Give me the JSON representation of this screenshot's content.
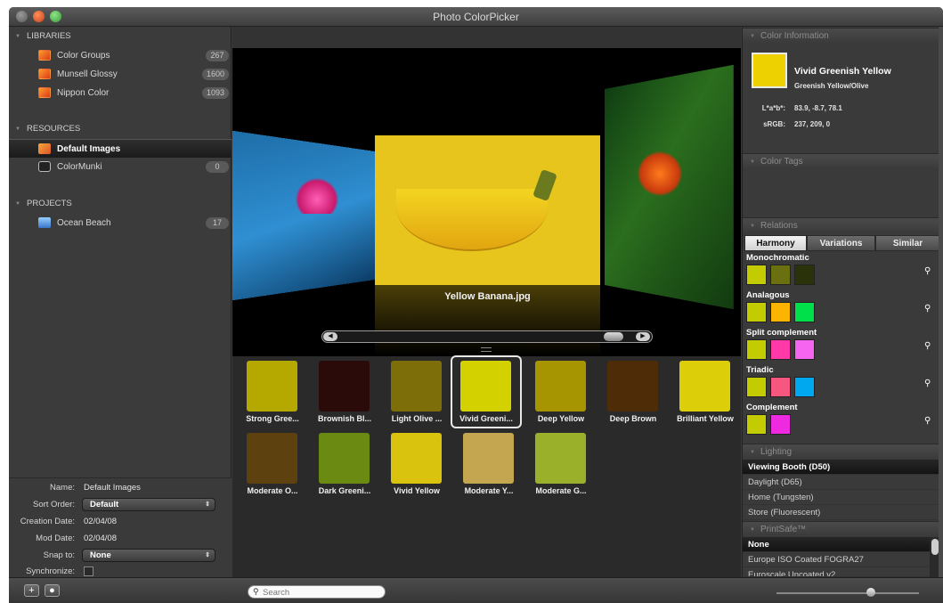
{
  "window": {
    "title": "Photo ColorPicker"
  },
  "sidebar": {
    "libraries_header": "LIBRARIES",
    "libraries": [
      {
        "label": "Color Groups",
        "count": "267"
      },
      {
        "label": "Munsell Glossy",
        "count": "1600"
      },
      {
        "label": "Nippon Color",
        "count": "1093"
      }
    ],
    "resources_header": "RESOURCES",
    "resources": [
      {
        "label": "Default Images",
        "count": ""
      },
      {
        "label": "ColorMunki",
        "count": "0"
      }
    ],
    "projects_header": "PROJECTS",
    "projects": [
      {
        "label": "Ocean Beach",
        "count": "17"
      }
    ]
  },
  "info": {
    "name_label": "Name:",
    "name_value": "Default Images",
    "sort_label": "Sort Order:",
    "sort_value": "Default",
    "creation_label": "Creation Date:",
    "creation_value": "02/04/08",
    "mod_label": "Mod Date:",
    "mod_value": "02/04/08",
    "snap_label": "Snap to:",
    "snap_value": "None",
    "sync_label": "Synchronize:"
  },
  "coverflow": {
    "caption": "Yellow Banana.jpg"
  },
  "swatches": [
    {
      "label": "Strong Gree...",
      "color": "#b5a900"
    },
    {
      "label": "Brownish Bl...",
      "color": "#2b0a0a"
    },
    {
      "label": "Light Olive ...",
      "color": "#7e6e0a"
    },
    {
      "label": "Vivid Greeni...",
      "color": "#d4d100"
    },
    {
      "label": "Deep Yellow",
      "color": "#a69400"
    },
    {
      "label": "Deep Brown",
      "color": "#4e2c08"
    },
    {
      "label": "Brilliant Yellow",
      "color": "#dccf0a"
    },
    {
      "label": "Moderate O...",
      "color": "#5d4210"
    },
    {
      "label": "Dark Greeni...",
      "color": "#6a8a12"
    },
    {
      "label": "Vivid Yellow",
      "color": "#d9c30e"
    },
    {
      "label": "Moderate Y...",
      "color": "#c4a650"
    },
    {
      "label": "Moderate G...",
      "color": "#9bb02a"
    }
  ],
  "color_info": {
    "header": "Color Information",
    "name": "Vivid Greenish Yellow",
    "sub": "Greenish Yellow/Olive",
    "lab_label": "L*a*b*:",
    "lab_value": "83.9, -8.7, 78.1",
    "srgb_label": "sRGB:",
    "srgb_value": "237, 209, 0",
    "color": "#edd100"
  },
  "color_tags": {
    "header": "Color Tags"
  },
  "relations": {
    "header": "Relations",
    "tabs": [
      "Harmony",
      "Variations",
      "Similar"
    ],
    "groups": [
      {
        "name": "Monochromatic",
        "colors": [
          "#c3cc00",
          "#6a6f10",
          "#2a320a"
        ]
      },
      {
        "name": "Analagous",
        "colors": [
          "#c3cc00",
          "#fbb400",
          "#00e04a"
        ]
      },
      {
        "name": "Split complement",
        "colors": [
          "#c3cc00",
          "#ff3aa8",
          "#f565f0"
        ]
      },
      {
        "name": "Triadic",
        "colors": [
          "#c3cc00",
          "#f6577f",
          "#00a8f0"
        ]
      },
      {
        "name": "Complement",
        "colors": [
          "#c3cc00",
          "#ee2ae0"
        ]
      }
    ]
  },
  "lighting": {
    "header": "Lighting",
    "items": [
      "Viewing Booth (D50)",
      "Daylight (D65)",
      "Home (Tungsten)",
      "Store (Fluorescent)"
    ]
  },
  "printsafe": {
    "header": "PrintSafe™",
    "items": [
      "None",
      "Europe ISO Coated FOGRA27",
      "Euroscale Uncoated v2"
    ]
  },
  "bottom": {
    "search_placeholder": "Search"
  },
  "icons": {
    "search": "search-icon",
    "zoom": "magnifier-icon",
    "add": "plus-icon",
    "action": "record-icon"
  }
}
